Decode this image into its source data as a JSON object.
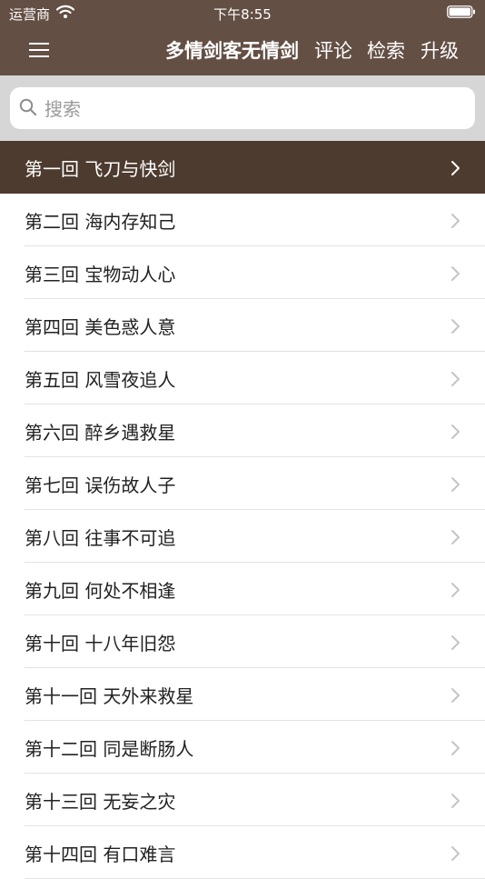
{
  "status_bar": {
    "carrier": "运营商",
    "time": "下午8:55"
  },
  "nav": {
    "title": "多情剑客无情剑",
    "buttons": [
      "评论",
      "检索",
      "升级"
    ]
  },
  "search": {
    "placeholder": "搜索"
  },
  "chapters": [
    "第一回 飞刀与快剑",
    "第二回 海内存知己",
    "第三回 宝物动人心",
    "第四回 美色惑人意",
    "第五回 风雪夜追人",
    "第六回 醉乡遇救星",
    "第七回 误伤故人子",
    "第八回 往事不可追",
    "第九回 何处不相逢",
    "第十回 十八年旧怨",
    "第十一回 天外来救星",
    "第十二回 同是断肠人",
    "第十三回 无妄之灾",
    "第十四回 有口难言"
  ],
  "selected_index": 0,
  "colors": {
    "nav_bg": "#634f44",
    "selected_row_bg": "#4d3b2f",
    "search_bar_bg": "#d6d6d6"
  }
}
